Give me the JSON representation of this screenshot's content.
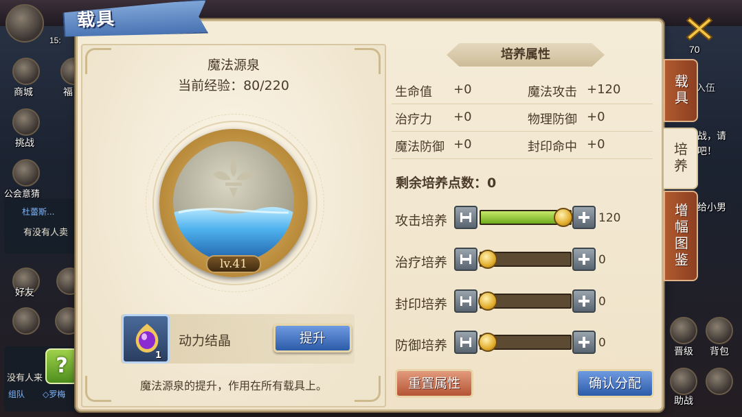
{
  "window": {
    "title": "载具"
  },
  "item": {
    "name": "魔法源泉",
    "exp_label": "当前经验：80/220",
    "level_badge": "lv.41",
    "material": {
      "name": "动力结晶",
      "count": "1"
    },
    "upgrade_label": "提升",
    "description": "魔法源泉的提升，作用在所有载具上。"
  },
  "attributes": {
    "header": "培养属性",
    "stats": [
      {
        "left_label": "生命值",
        "left_value": "+0",
        "right_label": "魔法攻击",
        "right_value": "+120"
      },
      {
        "left_label": "治疗力",
        "left_value": "+0",
        "right_label": "物理防御",
        "right_value": "+0"
      },
      {
        "left_label": "魔法防御",
        "left_value": "+0",
        "right_label": "封印命中",
        "right_value": "+0"
      }
    ],
    "points_label": "剩余培养点数：0"
  },
  "sliders": [
    {
      "label": "攻击培养",
      "value": "120",
      "level": 120
    },
    {
      "label": "治疗培养",
      "value": "0",
      "level": 0
    },
    {
      "label": "封印培养",
      "value": "0",
      "level": 0
    },
    {
      "label": "防御培养",
      "value": "0",
      "level": 0
    }
  ],
  "slider_max": 120,
  "buttons": {
    "reset": "重置属性",
    "confirm": "确认分配"
  },
  "side_tabs": [
    {
      "label": "载具",
      "active": false
    },
    {
      "label": "培养",
      "active": true
    },
    {
      "label": "增幅图鉴",
      "active": false
    }
  ],
  "background": {
    "top_left_text": "15:",
    "left_menu": [
      "商城",
      "福",
      "挑战",
      "公会意猜"
    ],
    "chat": {
      "speaker": "杜蕾斯...",
      "message": "有没有人卖"
    },
    "social": [
      "好友"
    ],
    "bottom_chat": {
      "text": "没有人来",
      "tags": [
        "组队",
        "◇罗梅"
      ]
    },
    "right_text": [
      "入伍",
      "战，请",
      "吧！",
      "给小男",
      "晋级",
      "背包",
      "助战"
    ],
    "level_badge": "70"
  },
  "colors": {
    "panel_bg": "#f5ecd8",
    "ribbon_blue": "#4872b2",
    "confirm_blue": "#2c5ba8",
    "reset_red": "#b45536",
    "tab_brown": "#8c3f20",
    "slider_green": "#6fab1e"
  }
}
